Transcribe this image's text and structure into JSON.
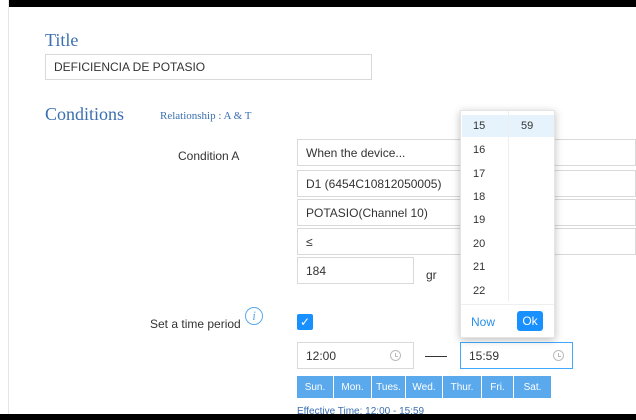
{
  "title_section": {
    "heading": "Title",
    "value": "DEFICIENCIA DE POTASIO"
  },
  "conditions_section": {
    "heading": "Conditions",
    "relationship": "Relationship :  A & T",
    "condition_a_label": "Condition A",
    "trigger": "When the device...",
    "device": "D1 (6454C10812050005)",
    "channel": "POTASIO(Channel 10)",
    "operator": "≤",
    "threshold": "184",
    "unit": "gr"
  },
  "time_period": {
    "label": "Set a time period",
    "start": "12:00",
    "end": "15:59",
    "days": [
      "Sun.",
      "Mon.",
      "Tues.",
      "Wed.",
      "Thur.",
      "Fri.",
      "Sat."
    ],
    "effective": "Effective Time: 12:00 - 15:59"
  },
  "time_picker": {
    "hours": [
      "15",
      "16",
      "17",
      "18",
      "19",
      "20",
      "21",
      "22"
    ],
    "minute": "59",
    "now_label": "Now",
    "ok_label": "Ok"
  },
  "icons": {
    "info": "info-icon",
    "clock": "clock-icon",
    "check": "check-icon"
  },
  "colors": {
    "accent": "#1890ff",
    "heading": "#3a6fb0",
    "day_bg": "#5aa9ec"
  }
}
